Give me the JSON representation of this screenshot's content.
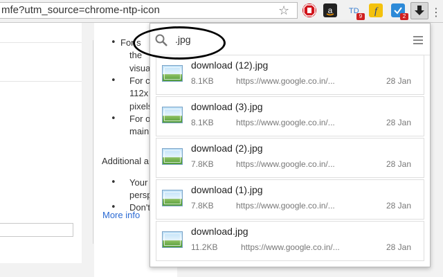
{
  "toolbar": {
    "url": "mfe?utm_source=chrome-ntp-icon",
    "extensions": [
      {
        "name": "adblock-icon",
        "color": "#d0131a",
        "badge": ""
      },
      {
        "name": "amazon-icon",
        "color": "#222222",
        "badge": ""
      },
      {
        "name": "td-icon",
        "color": "#3b7fd0",
        "badge": "9"
      },
      {
        "name": "flipkart-icon",
        "color": "#f4c20d",
        "badge": ""
      },
      {
        "name": "check-icon",
        "color": "#2d8ad8",
        "badge": "2"
      }
    ]
  },
  "page": {
    "bullets": [
      "For s",
      "For c",
      "For o",
      "Your",
      "Don't"
    ],
    "lines": [
      "the",
      "visua",
      "112x",
      "pixels",
      "main",
      "persp"
    ],
    "additional": "Additional a",
    "more_info": "More info"
  },
  "downloads": {
    "search_value": ".jpg",
    "items": [
      {
        "name": "download (12).jpg",
        "size": "8.1KB",
        "url": "https://www.google.co.in/...",
        "date": "28 Jan"
      },
      {
        "name": "download (3).jpg",
        "size": "8.1KB",
        "url": "https://www.google.co.in/...",
        "date": "28 Jan"
      },
      {
        "name": "download (2).jpg",
        "size": "7.8KB",
        "url": "https://www.google.co.in/...",
        "date": "28 Jan"
      },
      {
        "name": "download (1).jpg",
        "size": "7.8KB",
        "url": "https://www.google.co.in/...",
        "date": "28 Jan"
      },
      {
        "name": "download.jpg",
        "size": "11.2KB",
        "url": "https://www.google.co.in/...",
        "date": "28 Jan"
      }
    ]
  }
}
